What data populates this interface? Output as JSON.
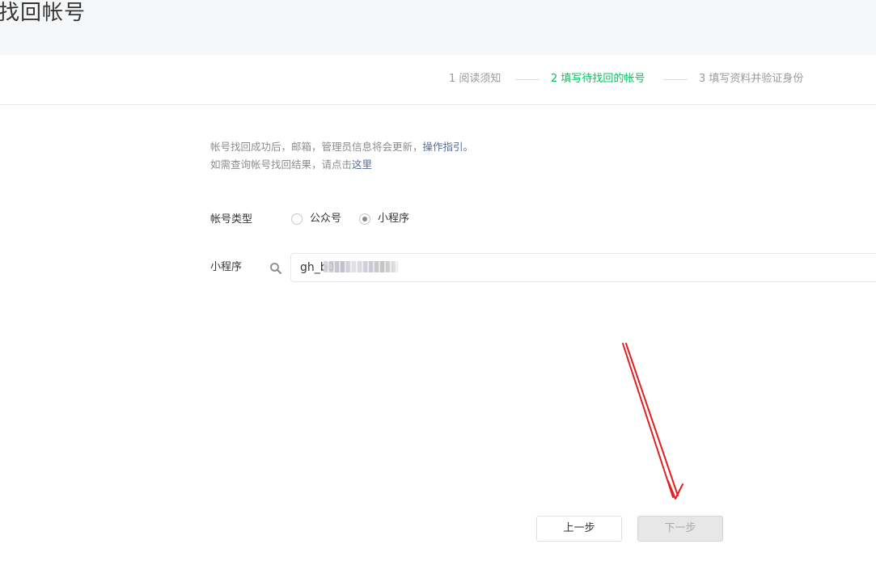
{
  "header": {
    "title": "找回帐号"
  },
  "steps": [
    {
      "label": "1 阅读须知",
      "active": false
    },
    {
      "label": "2 填写待找回的帐号",
      "active": true
    },
    {
      "label": "3 填写资料并验证身份",
      "active": false
    }
  ],
  "notice": {
    "line1": "帐号找回成功后，邮箱，管理员信息将会更新，",
    "line1_link": "操作指引。",
    "line2": "如需查询帐号找回结果，请点击",
    "line2_link": "这里"
  },
  "form": {
    "account_type_label": "帐号类型",
    "options": [
      {
        "label": "公众号",
        "selected": false
      },
      {
        "label": "小程序",
        "selected": true
      }
    ],
    "miniprogram_label": "小程序",
    "input_value": "gh_b0"
  },
  "buttons": {
    "prev": "上一步",
    "next": "下一步"
  },
  "colors": {
    "accent": "#07c160",
    "link": "#576b95",
    "annotation_arrow": "#e02020"
  },
  "icons": {
    "search": "search-icon",
    "annotation": "red-arrow-annotation"
  }
}
